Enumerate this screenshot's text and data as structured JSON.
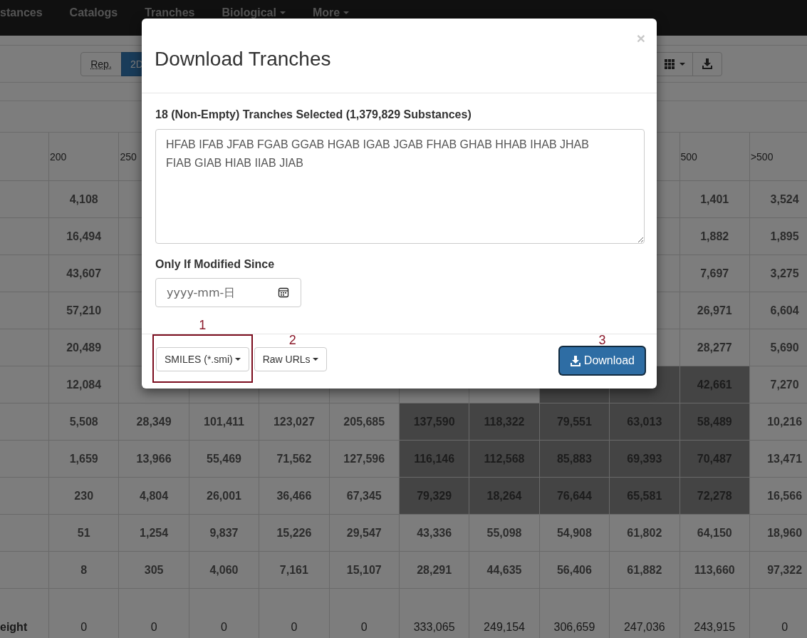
{
  "navbar": {
    "items": [
      {
        "label": "stances",
        "dropdown": false
      },
      {
        "label": "Catalogs",
        "dropdown": false
      },
      {
        "label": "Tranches",
        "dropdown": false
      },
      {
        "label": "Biological",
        "dropdown": true
      },
      {
        "label": "More",
        "dropdown": true
      }
    ]
  },
  "toolbar": {
    "left": [
      {
        "label": "Rep.",
        "selected": false
      },
      {
        "label": "2D",
        "selected": true
      }
    ],
    "right": [
      {
        "kind": "grid",
        "dropdown": true
      },
      {
        "kind": "download",
        "dropdown": false
      }
    ]
  },
  "table": {
    "columns": [
      {
        "label": "200"
      },
      {
        "label": "250"
      },
      {},
      {},
      {},
      {},
      {},
      {},
      {},
      {
        "label": "500"
      },
      {
        "label": ">500"
      }
    ],
    "rows": [
      {
        "cells": [
          {
            "text": "4,108",
            "selected": false
          },
          {},
          {},
          {},
          {},
          {},
          {},
          {},
          {
            "selected": false
          },
          {
            "text": "1,401",
            "selected": false
          },
          {
            "text": "3,524",
            "selected": false
          }
        ]
      },
      {
        "cells": [
          {
            "text": "16,494",
            "selected": false
          },
          {},
          {},
          {},
          {},
          {},
          {},
          {},
          {
            "selected": false
          },
          {
            "text": "1,882",
            "selected": false
          },
          {
            "text": "1,895",
            "selected": false
          }
        ]
      },
      {
        "cells": [
          {
            "text": "43,607",
            "selected": false
          },
          {},
          {},
          {},
          {},
          {},
          {},
          {},
          {
            "selected": false
          },
          {
            "text": "7,697",
            "selected": false
          },
          {
            "text": "3,275",
            "selected": false
          }
        ]
      },
      {
        "cells": [
          {
            "text": "57,210",
            "selected": false
          },
          {},
          {},
          {},
          {},
          {},
          {},
          {},
          {
            "selected": false
          },
          {
            "text": "26,971",
            "selected": false
          },
          {
            "text": "6,604",
            "selected": false
          }
        ]
      },
      {
        "cells": [
          {
            "text": "20,489",
            "selected": false
          },
          {},
          {},
          {},
          {},
          {},
          {},
          {},
          {
            "selected": false
          },
          {
            "text": "28,277",
            "selected": false
          },
          {
            "text": "5,690",
            "selected": false
          }
        ]
      },
      {
        "cells": [
          {
            "text": "12,084",
            "selected": false
          },
          {
            "selected": false
          },
          {
            "selected": false
          },
          {
            "selected": false
          },
          {
            "selected": false
          },
          {
            "selected": false
          },
          {
            "selected": false
          },
          {
            "selected": true
          },
          {
            "selected": true
          },
          {
            "text": "42,661",
            "selected": true
          },
          {
            "text": "7,270",
            "selected": false
          }
        ]
      },
      {
        "cells": [
          {
            "text": "5,508",
            "selected": false
          },
          {
            "text": "28,349",
            "selected": false
          },
          {
            "text": "101,411",
            "selected": false
          },
          {
            "text": "123,027",
            "selected": false
          },
          {
            "text": "205,685",
            "selected": false
          },
          {
            "text": "137,590",
            "selected": true
          },
          {
            "text": "118,322",
            "selected": true
          },
          {
            "text": "79,551",
            "selected": true
          },
          {
            "text": "63,013",
            "selected": true
          },
          {
            "text": "58,489",
            "selected": true
          },
          {
            "text": "10,216",
            "selected": false
          }
        ]
      },
      {
        "cells": [
          {
            "text": "1,659",
            "selected": false
          },
          {
            "text": "13,966",
            "selected": false
          },
          {
            "text": "55,469",
            "selected": false
          },
          {
            "text": "71,562",
            "selected": false
          },
          {
            "text": "127,596",
            "selected": false
          },
          {
            "text": "116,146",
            "selected": true
          },
          {
            "text": "112,568",
            "selected": true
          },
          {
            "text": "85,883",
            "selected": true
          },
          {
            "text": "69,393",
            "selected": true
          },
          {
            "text": "70,487",
            "selected": true
          },
          {
            "text": "13,471",
            "selected": false
          }
        ]
      },
      {
        "cells": [
          {
            "text": "230",
            "selected": false
          },
          {
            "text": "4,804",
            "selected": false
          },
          {
            "text": "26,001",
            "selected": false
          },
          {
            "text": "36,466",
            "selected": false
          },
          {
            "text": "67,345",
            "selected": false
          },
          {
            "text": "79,329",
            "selected": true
          },
          {
            "text": "18,264",
            "selected": true
          },
          {
            "text": "76,644",
            "selected": true
          },
          {
            "text": "65,581",
            "selected": true
          },
          {
            "text": "72,278",
            "selected": true
          },
          {
            "text": "16,566",
            "selected": false
          }
        ]
      },
      {
        "cells": [
          {
            "text": "51",
            "selected": false
          },
          {
            "text": "1,254",
            "selected": false
          },
          {
            "text": "9,837",
            "selected": false
          },
          {
            "text": "15,226",
            "selected": false
          },
          {
            "text": "29,547",
            "selected": false
          },
          {
            "text": "43,336",
            "selected": false
          },
          {
            "text": "55,098",
            "selected": false
          },
          {
            "text": "54,908",
            "selected": false
          },
          {
            "text": "61,802",
            "selected": false
          },
          {
            "text": "64,150",
            "selected": false
          },
          {
            "text": "18,960",
            "selected": false
          }
        ]
      },
      {
        "cells": [
          {
            "text": "8",
            "selected": false
          },
          {
            "text": "305",
            "selected": false
          },
          {
            "text": "4,060",
            "selected": false
          },
          {
            "text": "7,161",
            "selected": false
          },
          {
            "text": "15,107",
            "selected": false
          },
          {
            "text": "28,291",
            "selected": false
          },
          {
            "text": "44,635",
            "selected": false
          },
          {
            "text": "56,406",
            "selected": false
          },
          {
            "text": "61,882",
            "selected": false
          },
          {
            "text": "113,660",
            "selected": false
          },
          {
            "text": "97,322",
            "selected": false
          }
        ]
      }
    ],
    "total_row": {
      "label": "eight",
      "cells": [
        "0",
        "0",
        "0",
        "0",
        "0",
        "333,065",
        "249,154",
        "306,659",
        "247,036",
        "243,915",
        "0"
      ]
    }
  },
  "modal": {
    "title": "Download Tranches",
    "close": "×",
    "selection_label": "18 (Non-Empty) Tranches Selected (1,379,829 Substances)",
    "tranches": "HFAB IFAB JFAB FGAB GGAB HGAB IGAB JGAB FHAB GHAB HHAB IHAB JHAB FIAB GIAB HIAB IIAB JIAB",
    "date_label": "Only If Modified Since",
    "date_placeholder": "yyyy-mm-日",
    "buttons": [
      {
        "kind": "dropdown",
        "label": "SMILES (*.smi)",
        "marker": "1",
        "highlighted": true,
        "focused": false
      },
      {
        "kind": "dropdown",
        "label": "Raw URLs",
        "marker": "2",
        "highlighted": false,
        "focused": false
      },
      {
        "kind": "primary",
        "label": "Download",
        "marker": "3",
        "highlighted": false,
        "focused": true
      }
    ]
  }
}
